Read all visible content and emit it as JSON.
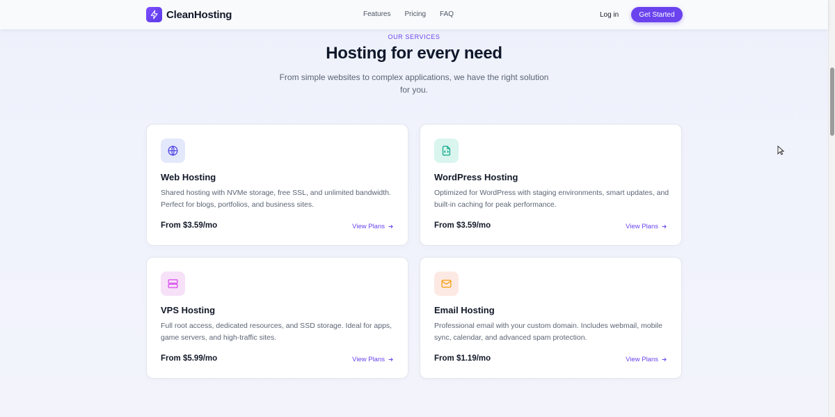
{
  "header": {
    "brand": "CleanHosting",
    "nav": [
      "Features",
      "Pricing",
      "FAQ"
    ],
    "login": "Log in",
    "cta": "Get Started"
  },
  "section": {
    "eyebrow": "OUR SERVICES",
    "title": "Hosting for every need",
    "subtitle": "From simple websites to complex applications, we have the right solution for you."
  },
  "cards": [
    {
      "icon": "globe-icon",
      "icon_bg": "#e4e8fb",
      "icon_color": "#4f46e5",
      "title": "Web Hosting",
      "desc": "Shared hosting with NVMe storage, free SSL, and unlimited bandwidth. Perfect for blogs, portfolios, and business sites.",
      "price": "From $3.59/mo",
      "link": "View Plans"
    },
    {
      "icon": "code-file-icon",
      "icon_bg": "#d9f5ee",
      "icon_color": "#10a98a",
      "title": "WordPress Hosting",
      "desc": "Optimized for WordPress with staging environments, smart updates, and built-in caching for peak performance.",
      "price": "From $3.59/mo",
      "link": "View Plans"
    },
    {
      "icon": "server-icon",
      "icon_bg": "#f6e1f8",
      "icon_color": "#d946ef",
      "title": "VPS Hosting",
      "desc": "Full root access, dedicated resources, and SSD storage. Ideal for apps, game servers, and high-traffic sites.",
      "price": "From $5.99/mo",
      "link": "View Plans"
    },
    {
      "icon": "mail-icon",
      "icon_bg": "#fde9e3",
      "icon_color": "#f59e0b",
      "title": "Email Hosting",
      "desc": "Professional email with your custom domain. Includes webmail, mobile sync, calendar, and advanced spam protection.",
      "price": "From $1.19/mo",
      "link": "View Plans"
    }
  ],
  "colors": {
    "accent": "#6a43ee",
    "text": "#111827",
    "muted": "#5b6474"
  }
}
